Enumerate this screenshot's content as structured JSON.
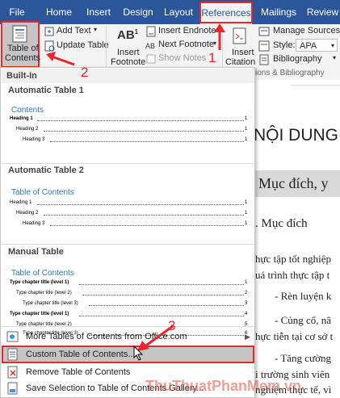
{
  "tabs": [
    "File",
    "Home",
    "Insert",
    "Design",
    "Layout",
    "References",
    "Mailings",
    "Review"
  ],
  "ribbon": {
    "toc_button": [
      "Table of",
      "Contents"
    ],
    "add_text": "Add Text",
    "update_table": "Update Table",
    "insert_footnote": [
      "Insert",
      "Footnote"
    ],
    "insert_endnote": "Insert Endnote",
    "next_footnote": "Next Footnote",
    "show_notes": "Show Notes",
    "insert_citation": [
      "Insert",
      "Citation"
    ],
    "manage_sources": "Manage Sources",
    "style_label": "Style:",
    "style_value": "APA",
    "bibliography": "Bibliography",
    "group_label": "ions & Bibliography"
  },
  "annotations": [
    "1",
    "2",
    "3"
  ],
  "menu": {
    "builtin_header": "Built-In",
    "auto1": {
      "title": "Automatic Table 1",
      "heading": "Contents",
      "lines": [
        {
          "text": "Heading 1",
          "page": "1"
        },
        {
          "text": "Heading 2",
          "page": "1"
        },
        {
          "text": "Heading 3",
          "page": "1"
        }
      ]
    },
    "auto2": {
      "title": "Automatic Table 2",
      "heading": "Table of Contents",
      "lines": [
        {
          "text": "Heading 1",
          "page": "1"
        },
        {
          "text": "Heading 2",
          "page": "1"
        },
        {
          "text": "Heading 3",
          "page": "1"
        }
      ]
    },
    "manual": {
      "title": "Manual Table",
      "heading": "Table of Contents",
      "lines": [
        {
          "text": "Type chapter title (level 1)",
          "page": "1"
        },
        {
          "text": "Type chapter title (level 2)",
          "page": "2"
        },
        {
          "text": "Type chapter title (level 3)",
          "page": "3"
        },
        {
          "text": "Type chapter title (level 1)",
          "page": "4"
        },
        {
          "text": "Type chapter title (level 2)",
          "page": "5"
        },
        {
          "text": "Type chapter title (level 3)",
          "page": "6"
        }
      ]
    },
    "items": {
      "more": "More Tables of Contents from Office.com",
      "custom": "Custom Table of Contents...",
      "remove": "Remove Table of Contents",
      "save": "Save Selection to Table of Contents Gallery..."
    }
  },
  "document": {
    "heading": "NỘI DUNG",
    "section_bar": "Mục đích, y",
    "subheading": ". Mục đích",
    "lines": [
      "hực tập tốt nghiệp",
      "uá trình thực tập t",
      "- Rèn luyện k",
      "- Củng cố, nâ",
      "hực tiễn tại cơ sở t",
      "- Tăng cường",
      "i trường sinh viên",
      "nghiệm thực tế, vì"
    ]
  },
  "watermark": "ThuThuatPhanMem.vn",
  "colors": {
    "ribbon_blue": "#2b579a",
    "annotation_red": "#e8262d",
    "toc_blue": "#2e74b5"
  }
}
